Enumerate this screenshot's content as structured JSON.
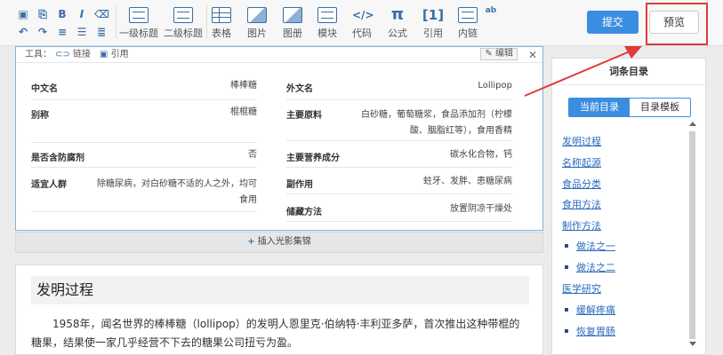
{
  "toolbar": {
    "tools": [
      {
        "icon": "heading1-icon",
        "label": "一级标题"
      },
      {
        "icon": "heading2-icon",
        "label": "二级标题"
      },
      {
        "icon": "table-icon",
        "label": "表格"
      },
      {
        "icon": "image-icon",
        "label": "图片"
      },
      {
        "icon": "album-icon",
        "label": "图册"
      },
      {
        "icon": "module-icon",
        "label": "模块"
      },
      {
        "icon": "code-icon",
        "label": "代码"
      },
      {
        "icon": "formula-icon",
        "label": "公式",
        "glyph": "π"
      },
      {
        "icon": "citation-icon",
        "label": "引用",
        "glyph": "[1]"
      },
      {
        "icon": "inner-link-icon",
        "label": "内链"
      }
    ],
    "submit_label": "提交",
    "preview_label": "预览"
  },
  "card": {
    "toolbar": {
      "tools_label": "工具：",
      "link_label": "链接",
      "citation_label": "引用",
      "edit_label": "编辑"
    },
    "rows": [
      {
        "key": "中文名",
        "value": "棒棒糖"
      },
      {
        "key": "外文名",
        "value": "Lollipop"
      },
      {
        "key": "别称",
        "value": "棍棍糖"
      },
      {
        "key": "主要原料",
        "value": "白砂糖，葡萄糖浆，食品添加剂（柠檬酸、胭脂红等），食用香精"
      },
      {
        "key": "是否含防腐剂",
        "value": "否"
      },
      {
        "key": "主要营养成分",
        "value": "碳水化合物，钙"
      },
      {
        "key": "适宜人群",
        "value": "除糖尿病，对白砂糖不适的人之外，均可食用"
      },
      {
        "key": "副作用",
        "value": "蛀牙、发胖、患糖尿病"
      },
      {
        "key": "储藏方法",
        "value": "放置阴凉干燥处"
      }
    ],
    "insert_label": "插入光影集锦"
  },
  "article": {
    "heading": "发明过程",
    "paragraph": "1958年，闻名世界的棒棒糖（lollipop）的发明人恩里克·伯纳特·丰利亚多萨，首次推出这种带棍的糖果，结果使一家几乎经营不下去的糖果公司扭亏为盈。"
  },
  "toc": {
    "title": "词条目录",
    "tab_current": "当前目录",
    "tab_template": "目录模板",
    "items": [
      {
        "label": "发明过程",
        "level": 1
      },
      {
        "label": "名称起源",
        "level": 1
      },
      {
        "label": "食品分类",
        "level": 1
      },
      {
        "label": "食用方法",
        "level": 1
      },
      {
        "label": "制作方法",
        "level": 1
      },
      {
        "label": "做法之一",
        "level": 2
      },
      {
        "label": "做法之二",
        "level": 2
      },
      {
        "label": "医学研究",
        "level": 1
      },
      {
        "label": "缓解疼痛",
        "level": 2
      },
      {
        "label": "恢复胃肠",
        "level": 2
      }
    ]
  },
  "annotation": {
    "color": "#e03a3a"
  }
}
